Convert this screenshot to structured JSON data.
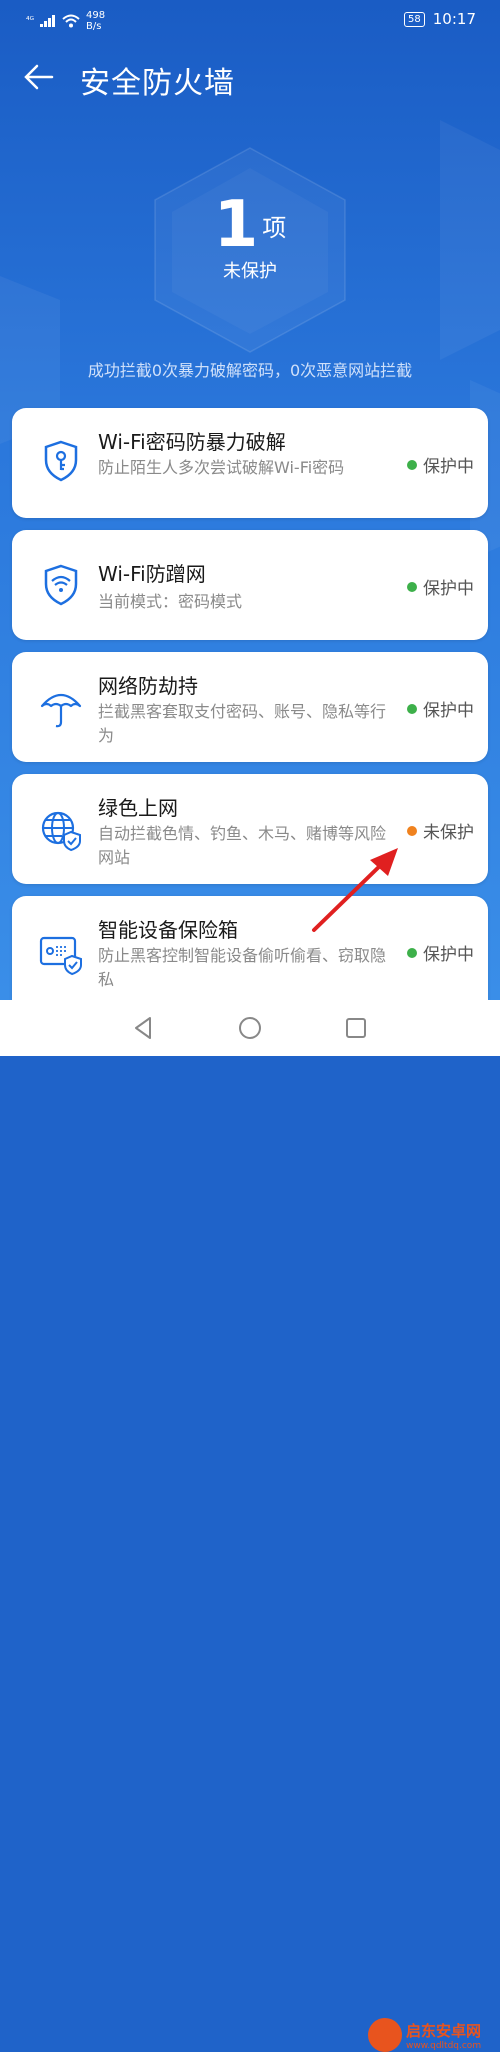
{
  "status_bar": {
    "signal": "⁴ᴳ",
    "net_speed_value": "498",
    "net_speed_unit": "B/s",
    "battery": "58",
    "time": "10:17"
  },
  "header": {
    "title": "安全防火墙"
  },
  "hero": {
    "count": "1",
    "unit": "项",
    "label": "未保护"
  },
  "summary": "成功拦截0次暴力破解密码，0次恶意网站拦截",
  "cards": [
    {
      "title": "Wi-Fi密码防暴力破解",
      "desc": "防止陌生人多次尝试破解Wi-Fi密码",
      "status": "保护中",
      "status_color": "#3db04a",
      "icon": "shield-key-icon"
    },
    {
      "title": "Wi-Fi防蹭网",
      "desc": "当前模式：密码模式",
      "status": "保护中",
      "status_color": "#3db04a",
      "icon": "wifi-shield-icon"
    },
    {
      "title": "网络防劫持",
      "desc": "拦截黑客套取支付密码、账号、隐私等行为",
      "status": "保护中",
      "status_color": "#3db04a",
      "icon": "umbrella-icon"
    },
    {
      "title": "绿色上网",
      "desc": "自动拦截色情、钓鱼、木马、赌博等风险网站",
      "status": "未保护",
      "status_color": "#f0821e",
      "icon": "globe-shield-icon"
    },
    {
      "title": "智能设备保险箱",
      "desc": "防止黑客控制智能设备偷听偷看、窃取隐私",
      "status": "保护中",
      "status_color": "#3db04a",
      "icon": "device-shield-icon"
    }
  ],
  "watermark": {
    "name": "启东安卓网",
    "url": "www.qdltdq.com"
  },
  "colors": {
    "accent_blue": "#1d6fe0",
    "protected_green": "#3db04a",
    "unprotected_orange": "#f0821e"
  }
}
